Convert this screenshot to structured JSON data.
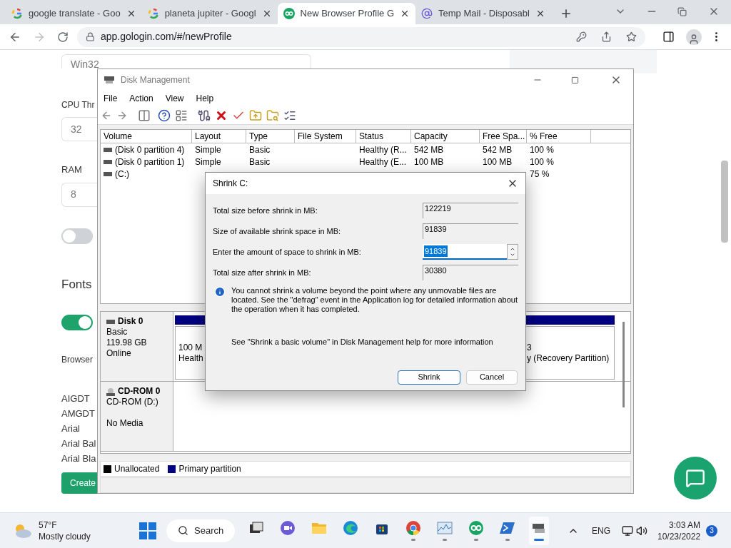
{
  "browser": {
    "tabs": [
      {
        "title": "google translate - Goo",
        "kind": "google",
        "selected": false
      },
      {
        "title": "planeta jupiter - Googl",
        "kind": "google",
        "selected": false
      },
      {
        "title": "New Browser Profile G",
        "kind": "gologin",
        "selected": true
      },
      {
        "title": "Temp Mail - Disposabl",
        "kind": "at",
        "selected": false
      }
    ],
    "url": "app.gologin.com/#/newProfile"
  },
  "page": {
    "platform_field": "Win32",
    "cpu_label": "CPU Thr",
    "cpu_field": "32",
    "ram_label": "RAM",
    "ram_field": "8",
    "toggles": [
      {
        "on": false
      },
      {
        "on": true
      }
    ],
    "fonts_heading": "Fonts",
    "browser_label": "Browser",
    "fonts": [
      "AIGDT",
      "AMGDT",
      "Arial",
      "Arial Bal",
      "Arial Bla"
    ],
    "create_button": "Create"
  },
  "disk_management": {
    "title": "Disk Management",
    "menu": [
      "File",
      "Action",
      "View",
      "Help"
    ],
    "columns": [
      "Volume",
      "Layout",
      "Type",
      "File System",
      "Status",
      "Capacity",
      "Free Spa...",
      "% Free"
    ],
    "rows": [
      {
        "volume": "(Disk 0 partition 4)",
        "layout": "Simple",
        "type": "Basic",
        "status": "Healthy (R...",
        "capacity": "542 MB",
        "free_space": "542 MB",
        "percent_free": "100 %"
      },
      {
        "volume": "(Disk 0 partition 1)",
        "layout": "Simple",
        "type": "Basic",
        "status": "Healthy (E...",
        "capacity": "100 MB",
        "free_space": "100 MB",
        "percent_free": "100 %"
      },
      {
        "volume": "(C:)",
        "percent_free": "75 %"
      }
    ],
    "disks": [
      {
        "kind": "disk",
        "name": "Disk 0",
        "details": [
          "Basic",
          "119.98 GB",
          "Online"
        ],
        "partitions": [
          {
            "lines": [
              "100 M",
              "Health"
            ]
          },
          {
            "lines": [
              "3",
              "y (Recovery Partition)"
            ]
          }
        ]
      },
      {
        "kind": "cdrom",
        "name": "CD-ROM 0",
        "details": [
          "CD-ROM (D:)"
        ],
        "status": "No Media"
      }
    ],
    "legend": [
      {
        "label": "Unallocated",
        "color": "#000000"
      },
      {
        "label": "Primary partition",
        "color": "#000080"
      }
    ]
  },
  "shrink_dialog": {
    "title": "Shrink C:",
    "fields": [
      {
        "label": "Total size before shrink in MB:",
        "value": "122219",
        "kind": "readonly"
      },
      {
        "label": "Size of available shrink space in MB:",
        "value": "91839",
        "kind": "readonly"
      },
      {
        "label": "Enter the amount of space to shrink in MB:",
        "value": "91839",
        "kind": "spin"
      },
      {
        "label": "Total size after shrink in MB:",
        "value": "30380",
        "kind": "readonly"
      }
    ],
    "info": "You cannot shrink a volume beyond the point where any unmovable files are located. See the \"defrag\" event in the Application log for detailed information about the operation when it has completed.",
    "help": "See \"Shrink a basic volume\" in Disk Management help for more information",
    "buttons": [
      {
        "label": "Shrink",
        "default": true
      },
      {
        "label": "Cancel",
        "default": false
      }
    ]
  },
  "taskbar": {
    "temperature": "57°F",
    "weather": "Mostly cloudy",
    "search": "Search",
    "apps": [
      {
        "kind": "taskview",
        "running": false,
        "active": false
      },
      {
        "kind": "meet",
        "running": false,
        "active": false
      },
      {
        "kind": "folder",
        "running": false,
        "active": false
      },
      {
        "kind": "edge",
        "running": false,
        "active": false
      },
      {
        "kind": "store",
        "running": false,
        "active": false
      },
      {
        "kind": "chrome",
        "running": true,
        "active": false
      },
      {
        "kind": "monitor",
        "running": true,
        "active": false
      },
      {
        "kind": "gologin",
        "running": true,
        "active": false
      },
      {
        "kind": "terminal",
        "running": true,
        "active": false
      },
      {
        "kind": "diskmgmt",
        "running": true,
        "active": true
      }
    ],
    "language": "ENG",
    "time": "3:03 AM",
    "date": "10/23/2022",
    "notifications": "3"
  }
}
